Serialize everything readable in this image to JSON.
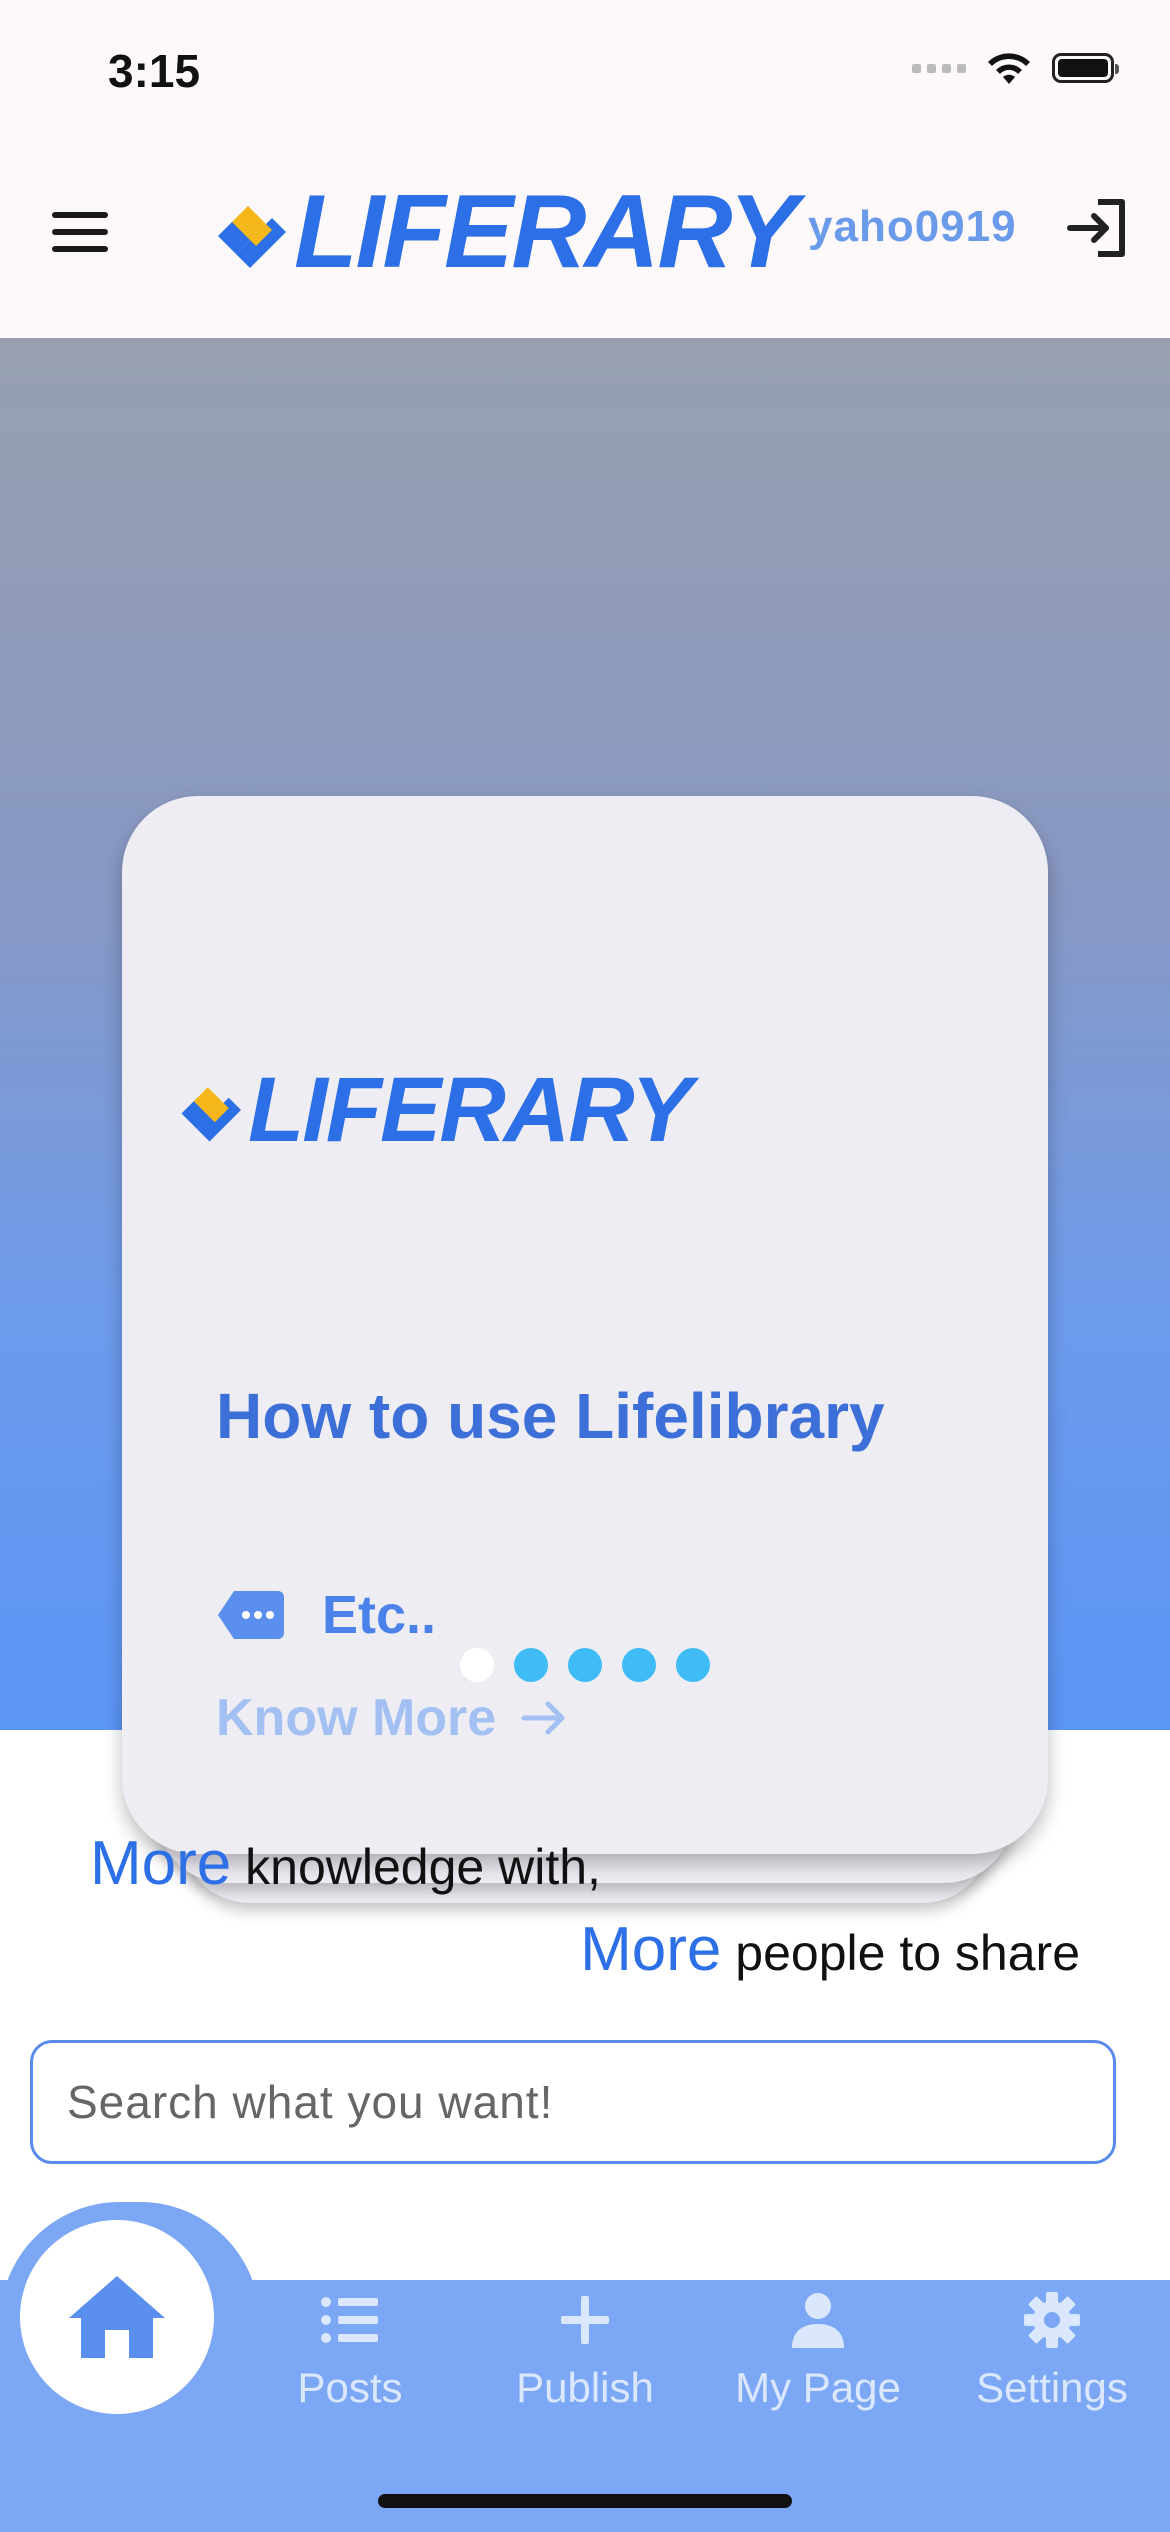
{
  "status_bar": {
    "time": "3:15"
  },
  "header": {
    "logo_text": "LIFERARY",
    "username": "yaho0919"
  },
  "carousel": {
    "card": {
      "logo_text": "LIFERARY",
      "title": "How to use Lifelibrary",
      "tag": "Etc..",
      "link": "Know More"
    },
    "dot_count": 5,
    "active_index": 0
  },
  "tagline": {
    "accent1": "More",
    "line1_rest": " knowledge with,",
    "accent2": "More",
    "line2_rest": " people to share"
  },
  "search": {
    "placeholder": "Search what you want!"
  },
  "tabbar": {
    "posts": "Posts",
    "publish": "Publish",
    "mypage": "My Page",
    "settings": "Settings"
  },
  "colors": {
    "brand": "#2c6fe6",
    "tabbar": "#7ba7f4",
    "logo_yellow": "#f5b71a"
  }
}
